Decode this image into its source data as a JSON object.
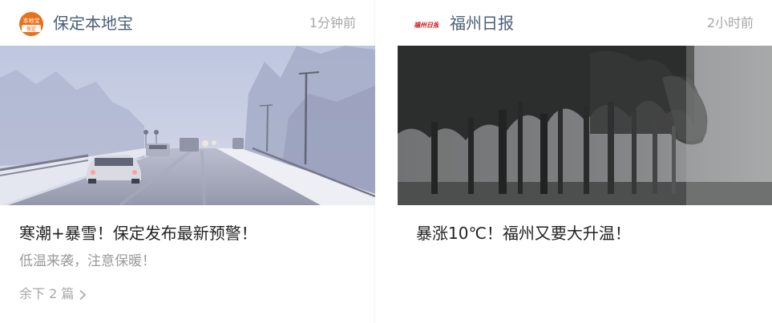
{
  "cards": [
    {
      "source": {
        "name": "保定本地宝",
        "logo_text_top": "本地宝",
        "logo_text_bottom": "保定",
        "logo_icon": "orange-badge-icon",
        "logo_color": "#e8711b"
      },
      "timestamp": "1分钟前",
      "image_icon": "snowy-highway-photo",
      "headline": "寒潮+暴雪！保定发布最新预警！",
      "summary": "低温来袭，注意保暖！",
      "more_label": "余下 2 篇",
      "more_icon": "chevron-right-icon"
    },
    {
      "source": {
        "name": "福州日报",
        "logo_text": "福州日报",
        "logo_icon": "red-calligraphy-logo-icon",
        "logo_color": "#d32222"
      },
      "timestamp": "2小时前",
      "image_icon": "foggy-trees-photo",
      "headline": "暴涨10℃！福州又要大升温！"
    }
  ],
  "colors": {
    "source_name": "#4a5e78",
    "timestamp": "#a7a7a7",
    "headline": "#222222",
    "summary": "#9a9a9a"
  }
}
